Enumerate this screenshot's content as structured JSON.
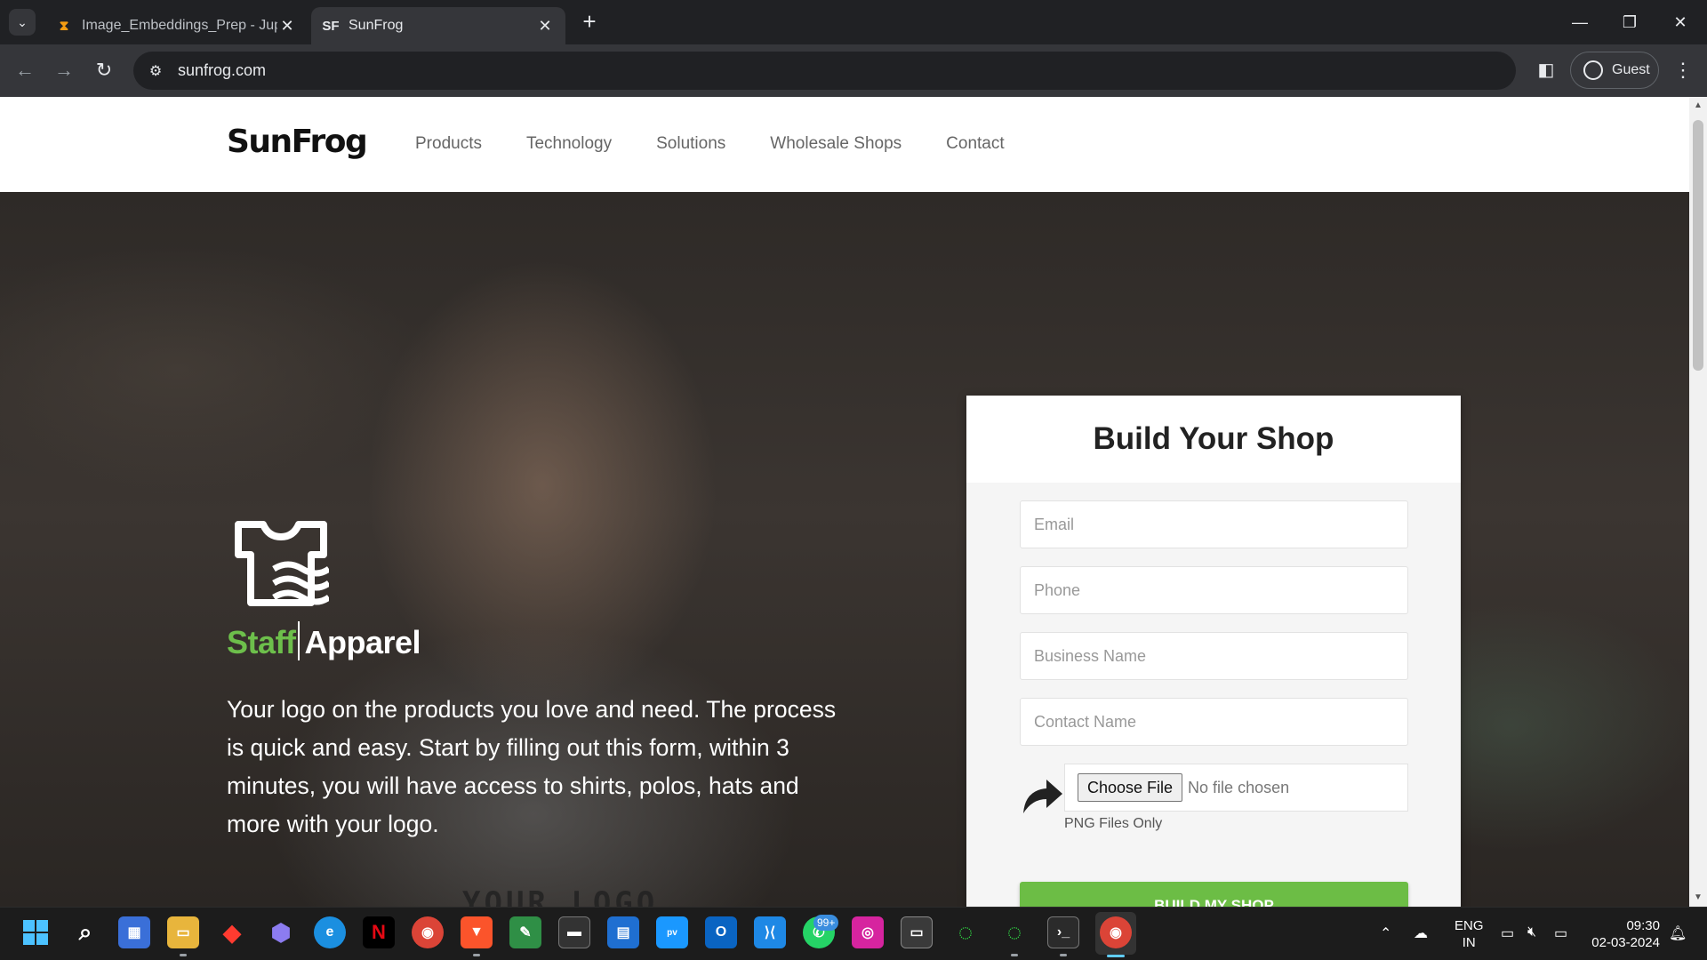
{
  "browser": {
    "tabs": [
      {
        "title": "Image_Embeddings_Prep - Jupyter",
        "favicon": "hourglass-icon",
        "active": false
      },
      {
        "title": "SunFrog",
        "favicon_text": "SF",
        "active": true
      }
    ],
    "url": "sunfrog.com",
    "profile_label": "Guest"
  },
  "site": {
    "logo": "SunFrog",
    "nav": [
      "Products",
      "Technology",
      "Solutions",
      "Wholesale Shops",
      "Contact"
    ]
  },
  "hero": {
    "brand_staff": "Staff",
    "brand_apparel": "Apparel",
    "description": "Your logo on the products you love and need. The process is quick and easy. Start by filling out this form, within 3 minutes, you will have access to shirts, polos, hats and more with your logo.",
    "shirt_print": "YOUR LOGO"
  },
  "form": {
    "title": "Build Your Shop",
    "email_placeholder": "Email",
    "phone_placeholder": "Phone",
    "business_placeholder": "Business Name",
    "contact_placeholder": "Contact Name",
    "file_button": "Choose File",
    "file_status": "No file chosen",
    "file_note": "PNG Files Only",
    "submit": "BUILD MY SHOP"
  },
  "taskbar": {
    "badge": "99+",
    "lang_line1": "ENG",
    "lang_line2": "IN",
    "time": "09:30",
    "date": "02-03-2024"
  },
  "colors": {
    "accent_green": "#6cbd45",
    "chrome_dark": "#202124",
    "chrome_toolbar": "#35363a"
  }
}
